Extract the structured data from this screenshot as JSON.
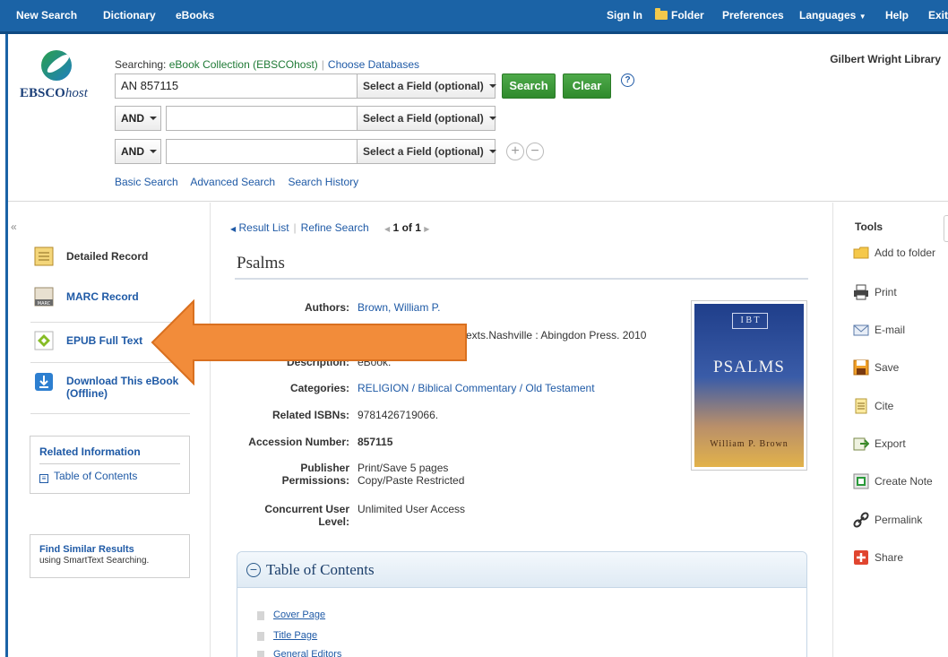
{
  "topbar": {
    "left": [
      "New Search",
      "Dictionary",
      "eBooks"
    ],
    "right": {
      "sign_in": "Sign In",
      "folder": "Folder",
      "preferences": "Preferences",
      "languages": "Languages",
      "help": "Help",
      "exit": "Exit"
    }
  },
  "logo": {
    "brand": "EBSCO",
    "brand_suffix": "host"
  },
  "search": {
    "searching_label": "Searching:",
    "database": "eBook Collection (EBSCOhost)",
    "choose_databases": "Choose Databases",
    "query": "AN 857115",
    "field_select": "Select a Field (optional)",
    "bool_op": "AND",
    "search_button": "Search",
    "clear_button": "Clear",
    "help": "?",
    "links": [
      "Basic Search",
      "Advanced Search",
      "Search History"
    ]
  },
  "library_name": "Gilbert Wright Library",
  "left_nav": {
    "collapse": "«",
    "items": [
      "Detailed Record",
      "MARC Record",
      "EPUB Full Text",
      "Download This eBook (Offline)"
    ],
    "related_title": "Related Information",
    "related_link": "Table of Contents",
    "similar_title": "Find Similar Results",
    "similar_sub": "using SmartText Searching."
  },
  "result_nav": {
    "result_list": "Result List",
    "refine": "Refine Search",
    "count_bold": "1",
    "count_rest": "of 1"
  },
  "record": {
    "title": "Psalms",
    "fields": [
      {
        "label": "Authors:",
        "value": "Brown, William P.",
        "link": true
      },
      {
        "label": "",
        "value": "Texts.Nashville : Abingdon Press. 2010",
        "link": false
      },
      {
        "label": "Description:",
        "value": "eBook.",
        "link": false
      },
      {
        "label": "Categories:",
        "value": "RELIGION / Biblical Commentary / Old Testament",
        "link": true
      },
      {
        "label": "Related ISBNs:",
        "value": "9781426719066.",
        "link": false
      },
      {
        "label": "Accession Number:",
        "value": "857115",
        "link": false,
        "bold": true
      },
      {
        "label": "Publisher Permissions:",
        "value": "Print/Save 5 pages\nCopy/Paste Restricted",
        "link": false
      },
      {
        "label": "Concurrent User Level:",
        "value": "Unlimited User Access",
        "link": false
      }
    ],
    "publisher_label_1": "Publisher",
    "publisher_label_2": "Permissions:",
    "publisher_val_1": "Print/Save 5 pages",
    "publisher_val_2": "Copy/Paste Restricted",
    "concurrent_label_1": "Concurrent User",
    "concurrent_label_2": "Level:"
  },
  "cover": {
    "series_mark": "I B T",
    "title": "PSALMS",
    "author": "William P. Brown"
  },
  "toc": {
    "title": "Table of Contents",
    "items": [
      "Cover Page",
      "Title Page",
      "General Editors"
    ]
  },
  "tools": {
    "title": "Tools",
    "items": [
      "Add to folder",
      "Print",
      "E-mail",
      "Save",
      "Cite",
      "Export",
      "Create Note",
      "Permalink",
      "Share"
    ]
  },
  "colors": {
    "topbar": "#1b63a6",
    "link": "#1f5aa6",
    "green_button": "#3a9a36",
    "arrow": "#f28c3a"
  }
}
